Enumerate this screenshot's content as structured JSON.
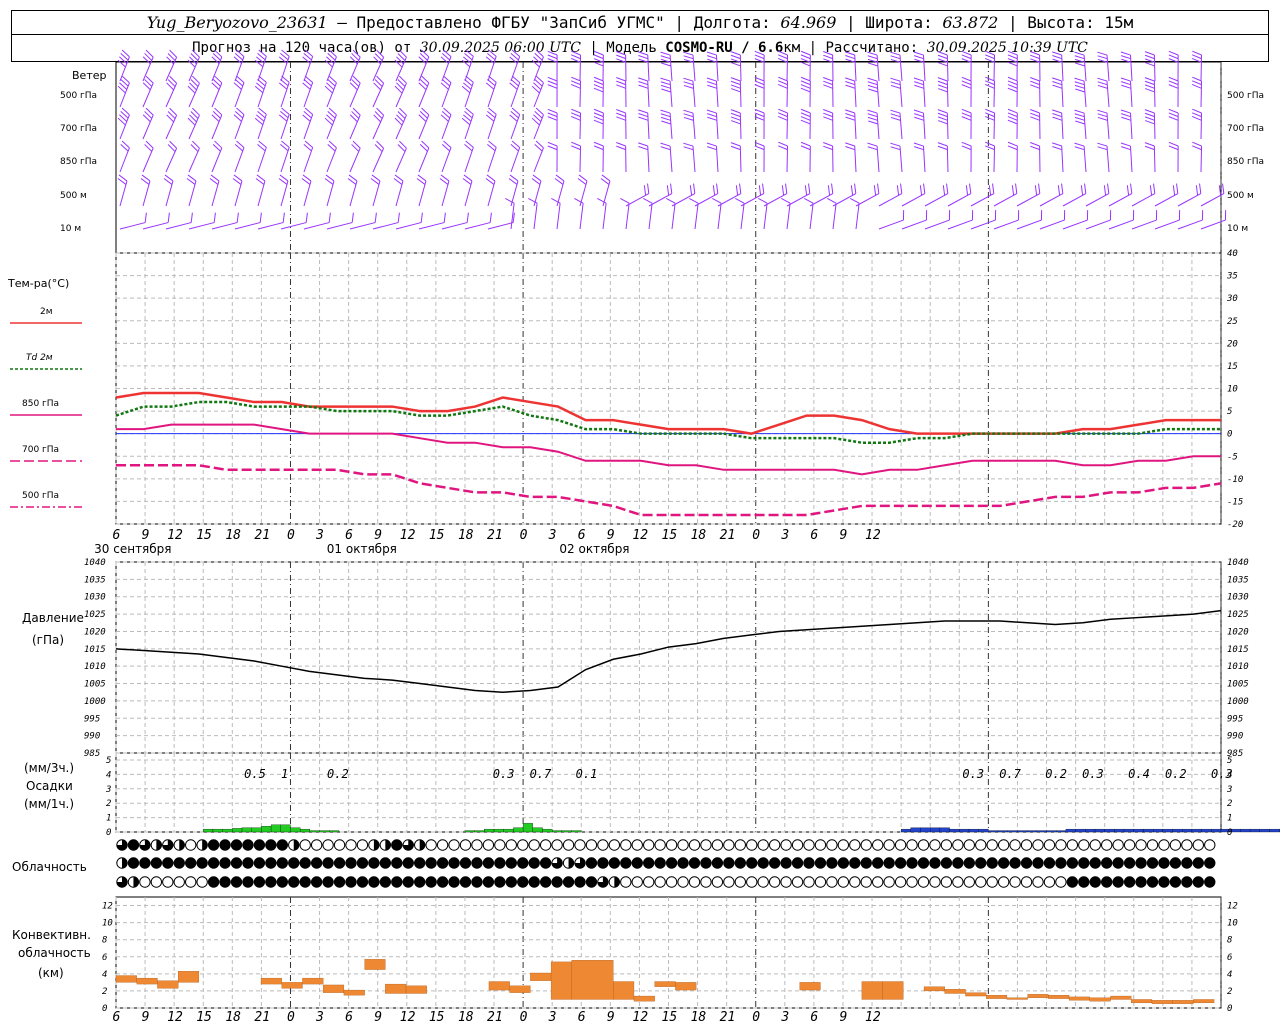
{
  "header": {
    "station": "Yug_Beryozovo_23631",
    "provider": "– Предоставлено ФГБУ \"ЗапСиб УГМС\"",
    "lon_label": "Долгота:",
    "lon": "64.969",
    "lat_label": "Широта:",
    "lat": "63.872",
    "alt_label": "Высота:",
    "alt": "15м",
    "forecast_label": "Прогноз на 120 часа(ов) от",
    "forecast_from": "30.09.2025 06:00 UTC",
    "model_label": "Модель",
    "model": "COSMO-RU / 6.6",
    "model_unit": "км",
    "calc_label": "Рассчитано:",
    "calc_time": "30.09.2025 10:39 UTC"
  },
  "wind_panel": {
    "title": "Ветер",
    "levels": [
      "500 гПа",
      "700 гПа",
      "850 гПа",
      "500 м",
      "10 м"
    ],
    "barb_color": "#9933ff"
  },
  "temp_panel": {
    "title": "Тем-ра(°С)",
    "legend": [
      {
        "label": "2м",
        "color": "#ee3333"
      },
      {
        "label": "Td 2м",
        "color": "#117711"
      },
      {
        "label": "850 гПа",
        "color": "#e0157f"
      },
      {
        "label": "700 гПа",
        "color": "#e0157f"
      },
      {
        "label": "500 гПа",
        "color": "#e0157f"
      }
    ]
  },
  "time_axis": {
    "hour_labels": [
      "6",
      "9",
      "12",
      "15",
      "18",
      "21",
      "0",
      "3",
      "6",
      "9",
      "12",
      "15",
      "18",
      "21",
      "0",
      "3",
      "6",
      "9",
      "12",
      "15",
      "18",
      "21",
      "0",
      "3",
      "6",
      "9",
      "12"
    ],
    "dates": [
      "30 сентября",
      "01 октября",
      "02 октября"
    ]
  },
  "pressure_panel": {
    "title": "Давление",
    "unit": "(гПа)"
  },
  "precip_panel": {
    "unit3h": "(мм/3ч.)",
    "title": "Осадки",
    "unit1h": "(мм/1ч.)",
    "totals": [
      "0.5",
      "1",
      "0.2",
      "0.3",
      "0.7",
      "0.1",
      "0.3",
      "0.7",
      "0.2",
      "0.3",
      "0.4",
      "0.2",
      "0.3"
    ],
    "rain_color": "#22cc22",
    "snow_color": "#2244cc"
  },
  "cloud_panel": {
    "title": "Облачность"
  },
  "conv_panel": {
    "title1": "Конвективн.",
    "title2": "облачность",
    "unit": "(км)",
    "color": "#ee8833"
  },
  "chart_data": [
    {
      "type": "line",
      "title": "Тем-ра(°С)",
      "x_hours_from_start": [
        0,
        3,
        6,
        9,
        12,
        15,
        18,
        21,
        24,
        27,
        30,
        33,
        36,
        39,
        42,
        45,
        48,
        51,
        54,
        57,
        60,
        63,
        66,
        69,
        72,
        75,
        78,
        81,
        84,
        87,
        90,
        93,
        96,
        99,
        102,
        105,
        108,
        111,
        114,
        117,
        120
      ],
      "ylim": [
        -20,
        40
      ],
      "series": [
        {
          "name": "2м",
          "values": [
            8,
            9,
            9,
            9,
            8,
            7,
            7,
            6,
            6,
            6,
            6,
            5,
            5,
            6,
            8,
            7,
            6,
            3,
            3,
            2,
            1,
            1,
            1,
            0,
            2,
            4,
            4,
            3,
            1,
            0,
            0,
            0,
            0,
            0,
            0,
            1,
            1,
            2,
            3,
            3,
            3
          ]
        },
        {
          "name": "Td 2м",
          "values": [
            4,
            6,
            6,
            7,
            7,
            6,
            6,
            6,
            5,
            5,
            5,
            4,
            4,
            5,
            6,
            4,
            3,
            1,
            1,
            0,
            0,
            0,
            0,
            -1,
            -1,
            -1,
            -1,
            -2,
            -2,
            -1,
            -1,
            0,
            0,
            0,
            0,
            0,
            0,
            0,
            1,
            1,
            1
          ]
        },
        {
          "name": "850 гПа",
          "values": [
            1,
            1,
            2,
            2,
            2,
            2,
            1,
            0,
            0,
            0,
            0,
            -1,
            -2,
            -2,
            -3,
            -3,
            -4,
            -6,
            -6,
            -6,
            -7,
            -7,
            -8,
            -8,
            -8,
            -8,
            -8,
            -9,
            -8,
            -8,
            -7,
            -6,
            -6,
            -6,
            -6,
            -7,
            -7,
            -6,
            -6,
            -5,
            -5
          ]
        },
        {
          "name": "700 гПа",
          "values": [
            -7,
            -7,
            -7,
            -7,
            -8,
            -8,
            -8,
            -8,
            -8,
            -9,
            -9,
            -11,
            -12,
            -13,
            -13,
            -14,
            -14,
            -15,
            -16,
            -18,
            -18,
            -18,
            -18,
            -18,
            -18,
            -18,
            -17,
            -16,
            -16,
            -16,
            -16,
            -16,
            -16,
            -15,
            -14,
            -14,
            -13,
            -13,
            -12,
            -12,
            -11
          ]
        },
        {
          "name": "500 гПа",
          "values": []
        }
      ]
    },
    {
      "type": "line",
      "title": "Давление",
      "ylabel": "(гПа)",
      "ylim": [
        985,
        1040
      ],
      "x_hours_from_start": [
        0,
        3,
        6,
        9,
        12,
        15,
        18,
        21,
        24,
        27,
        30,
        33,
        36,
        39,
        42,
        45,
        48,
        51,
        54,
        57,
        60,
        63,
        66,
        69,
        72,
        75,
        78,
        81,
        84,
        87,
        90,
        93,
        96,
        99,
        102,
        105,
        108,
        111,
        114,
        117,
        120
      ],
      "series": [
        {
          "name": "Давление",
          "values": [
            1015,
            1014.5,
            1014,
            1013.5,
            1012.5,
            1011.5,
            1010,
            1008.5,
            1007.5,
            1006.5,
            1006,
            1005,
            1004,
            1003,
            1002.5,
            1003,
            1004,
            1009,
            1012,
            1013.5,
            1015.5,
            1016.5,
            1018,
            1019,
            1020,
            1020.5,
            1021,
            1021.5,
            1022,
            1022.5,
            1023,
            1023,
            1023,
            1022.5,
            1022,
            1022.5,
            1023.5,
            1024,
            1024.5,
            1025,
            1026
          ]
        }
      ]
    },
    {
      "type": "bar",
      "title": "Осадки",
      "ylabel": "(мм/1ч.)",
      "ylim": [
        0,
        5
      ],
      "series": [
        {
          "name": "rain",
          "x_hours": [
            9,
            10,
            11,
            12,
            13,
            14,
            15,
            16,
            17,
            18,
            19,
            20,
            21,
            22,
            23,
            24,
            25,
            26,
            27,
            36,
            37,
            38,
            39,
            40,
            41,
            42,
            43,
            44,
            45,
            46,
            47,
            48,
            49,
            50
          ],
          "values": [
            0.2,
            0.2,
            0.2,
            0.25,
            0.3,
            0.3,
            0.4,
            0.5,
            0.5,
            0.3,
            0.2,
            0.1,
            0.1,
            0.1,
            0,
            0,
            0,
            0,
            0,
            0.1,
            0.1,
            0.2,
            0.2,
            0.2,
            0.3,
            0.6,
            0.3,
            0.2,
            0.1,
            0.1,
            0.1,
            0,
            0,
            0
          ]
        },
        {
          "name": "snow",
          "x_hours": [
            81,
            82,
            83,
            84,
            85,
            86,
            87,
            88,
            89,
            90,
            91,
            92,
            93,
            94,
            95,
            96,
            97,
            98,
            99,
            100,
            101,
            102,
            103,
            104,
            105,
            106,
            107,
            108,
            109,
            110,
            111,
            112,
            113,
            114,
            115,
            116,
            117,
            118,
            119,
            120
          ],
          "values": [
            0.2,
            0.3,
            0.3,
            0.3,
            0.3,
            0.2,
            0.2,
            0.2,
            0.2,
            0.1,
            0.1,
            0.1,
            0.1,
            0.1,
            0.1,
            0.1,
            0.1,
            0.2,
            0.2,
            0.2,
            0.2,
            0.2,
            0.2,
            0.2,
            0.2,
            0.2,
            0.2,
            0.2,
            0.2,
            0.2,
            0.2,
            0.2,
            0.2,
            0.2,
            0.2,
            0.2,
            0.2,
            0.2,
            0.2,
            0.2
          ]
        }
      ]
    },
    {
      "type": "bar",
      "title": "Конвективн. облачность",
      "ylabel": "(км)",
      "ylim": [
        0,
        13
      ],
      "segments_hours_base_top_km": [
        [
          0,
          3,
          3,
          3.8
        ],
        [
          3,
          6,
          2.8,
          3.5
        ],
        [
          6,
          9,
          2.3,
          3.2
        ],
        [
          9,
          12,
          3.0,
          4.3
        ],
        [
          21,
          24,
          2.8,
          3.5
        ],
        [
          24,
          27,
          2.3,
          3.0
        ],
        [
          27,
          30,
          2.8,
          3.5
        ],
        [
          30,
          33,
          1.8,
          2.7
        ],
        [
          33,
          36,
          1.5,
          2.1
        ],
        [
          36,
          39,
          4.5,
          5.7
        ],
        [
          39,
          42,
          1.7,
          2.8
        ],
        [
          42,
          45,
          1.7,
          2.6
        ],
        [
          54,
          57,
          2.1,
          3.1
        ],
        [
          57,
          60,
          1.8,
          2.6
        ],
        [
          60,
          63,
          3.2,
          4.1
        ],
        [
          63,
          66,
          1,
          5.4
        ],
        [
          66,
          72,
          1,
          5.6
        ],
        [
          72,
          75,
          1,
          3.1
        ],
        [
          75,
          78,
          0.8,
          1.4
        ],
        [
          78,
          81,
          2.5,
          3.1
        ],
        [
          81,
          84,
          2.1,
          3.0
        ],
        [
          99,
          102,
          2.1,
          3.0
        ],
        [
          108,
          111,
          1.0,
          3.1
        ],
        [
          111,
          114,
          1.0,
          3.1
        ],
        [
          117,
          120,
          2.0,
          2.5
        ],
        [
          120,
          123,
          1.7,
          2.2
        ],
        [
          123,
          126,
          1.4,
          1.8
        ],
        [
          126,
          129,
          1.1,
          1.5
        ],
        [
          129,
          132,
          1.0,
          1.2
        ],
        [
          132,
          135,
          1.2,
          1.6
        ],
        [
          135,
          138,
          1.1,
          1.5
        ],
        [
          138,
          141,
          0.9,
          1.3
        ],
        [
          141,
          144,
          0.8,
          1.2
        ],
        [
          144,
          147,
          1.0,
          1.4
        ],
        [
          147,
          150,
          0.6,
          1.0
        ],
        [
          150,
          153,
          0.5,
          0.9
        ],
        [
          153,
          156,
          0.5,
          0.9
        ],
        [
          156,
          159,
          0.6,
          1.0
        ]
      ]
    }
  ]
}
